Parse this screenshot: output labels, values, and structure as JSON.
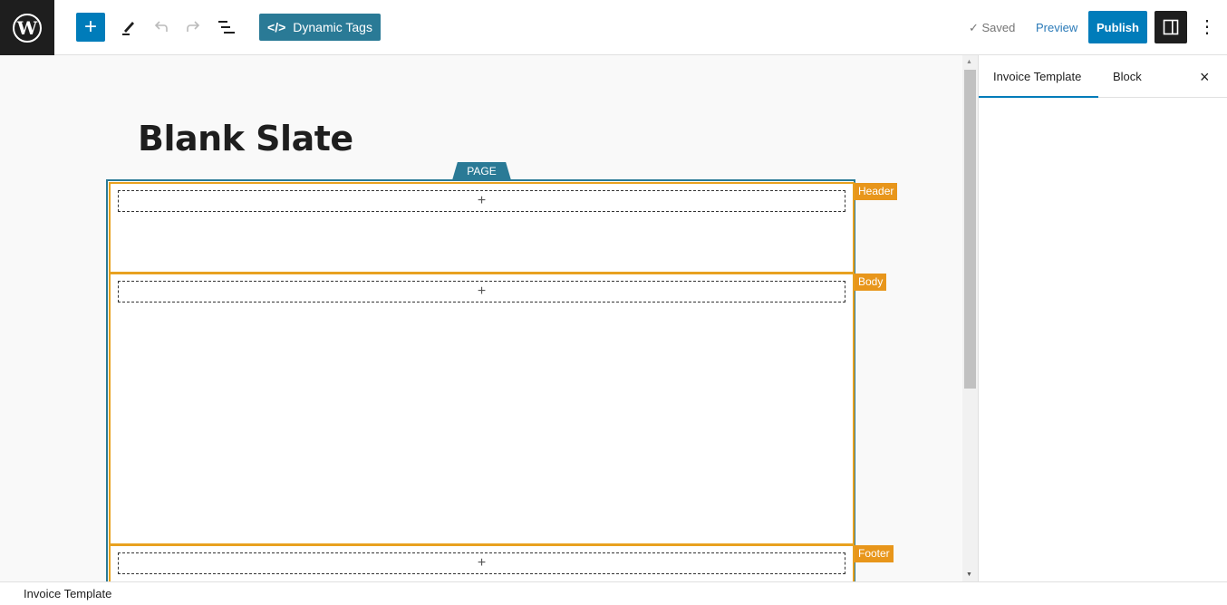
{
  "toolbar": {
    "dynamic_tags": "Dynamic Tags",
    "saved": "Saved",
    "preview": "Preview",
    "publish": "Publish"
  },
  "sidebar": {
    "tabs": [
      "Invoice Template",
      "Block"
    ]
  },
  "editor": {
    "title": "Blank Slate",
    "page_label": "PAGE",
    "sections": [
      "Header",
      "Body",
      "Footer"
    ]
  },
  "status": {
    "breadcrumb": "Invoice Template"
  }
}
